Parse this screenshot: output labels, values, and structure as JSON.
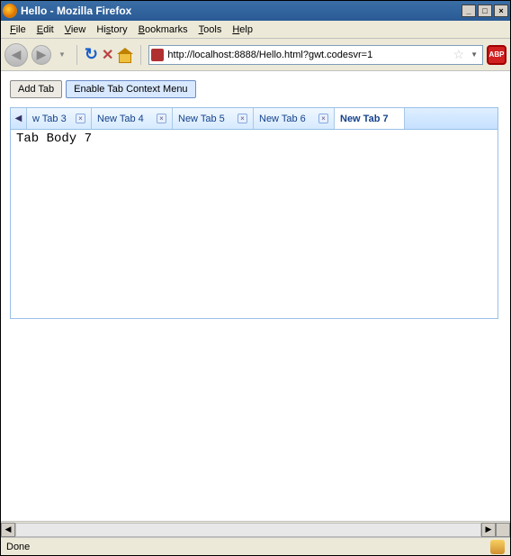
{
  "window": {
    "title": "Hello - Mozilla Firefox",
    "min_label": "_",
    "max_label": "□",
    "close_label": "×"
  },
  "menu": {
    "file": "File",
    "edit": "Edit",
    "view": "View",
    "history": "History",
    "bookmarks": "Bookmarks",
    "tools": "Tools",
    "help": "Help"
  },
  "nav": {
    "url": "http://localhost:8888/Hello.html?gwt.codesvr=1",
    "abp": "ABP"
  },
  "buttons": {
    "add_tab": "Add Tab",
    "enable_ctx": "Enable Tab Context Menu"
  },
  "tabs": {
    "scroll_left": "◀",
    "items": [
      {
        "label": "w Tab 3",
        "closable": true,
        "active": false
      },
      {
        "label": "New Tab 4",
        "closable": true,
        "active": false
      },
      {
        "label": "New Tab 5",
        "closable": true,
        "active": false
      },
      {
        "label": "New Tab 6",
        "closable": true,
        "active": false
      },
      {
        "label": "New Tab 7",
        "closable": false,
        "active": true
      }
    ],
    "body": "Tab Body 7"
  },
  "status": {
    "text": "Done"
  }
}
